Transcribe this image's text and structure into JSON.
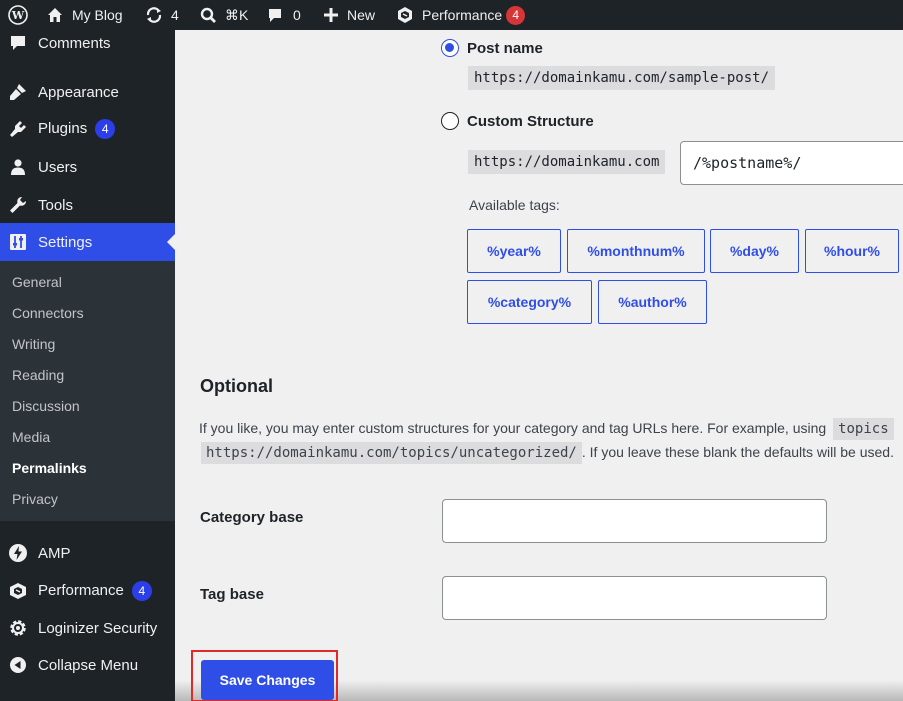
{
  "adminbar": {
    "site_name": "My Blog",
    "updates_count": "4",
    "search_shortcut": "⌘K",
    "comments_count": "0",
    "new_label": "New",
    "performance_label": "Performance",
    "performance_count": "4"
  },
  "sidebar": {
    "items": [
      {
        "label": "Comments",
        "icon": "comment-icon"
      },
      {
        "label": "Appearance",
        "icon": "brush-icon"
      },
      {
        "label": "Plugins",
        "icon": "plugin-icon",
        "badge": "4"
      },
      {
        "label": "Users",
        "icon": "user-icon"
      },
      {
        "label": "Tools",
        "icon": "wrench-icon"
      },
      {
        "label": "Settings",
        "icon": "settings-icon"
      },
      {
        "label": "AMP",
        "icon": "amp-icon"
      },
      {
        "label": "Performance",
        "icon": "performance-icon",
        "badge": "4"
      },
      {
        "label": "Loginizer Security",
        "icon": "gear-icon"
      },
      {
        "label": "Collapse Menu",
        "icon": "collapse-icon"
      }
    ],
    "submenu": [
      "General",
      "Connectors",
      "Writing",
      "Reading",
      "Discussion",
      "Media",
      "Permalinks",
      "Privacy"
    ]
  },
  "permalinks": {
    "post_name_label": "Post name",
    "post_name_example": "https://domainkamu.com/sample-post/",
    "custom_label": "Custom Structure",
    "custom_prefix": "https://domainkamu.com",
    "custom_value": "/%postname%/",
    "available_tags_label": "Available tags:",
    "tags": [
      "%year%",
      "%monthnum%",
      "%day%",
      "%hour%",
      "%category%",
      "%author%"
    ]
  },
  "optional": {
    "heading": "Optional",
    "desc_1": "If you like, you may enter custom structures for your category and tag URLs here. For example, using",
    "desc_code_1": "topics",
    "desc_code_2": "https://domainkamu.com/topics/uncategorized/",
    "desc_2": ". If you leave these blank the defaults will be used.",
    "category_base_label": "Category base",
    "category_base_value": "",
    "tag_base_label": "Tag base",
    "tag_base_value": ""
  },
  "save_label": "Save Changes",
  "colors": {
    "accent": "#2f4ee8",
    "sidebar_bg": "#1d2327",
    "badge_red": "#d63638",
    "highlight_box": "#e02a2a"
  }
}
